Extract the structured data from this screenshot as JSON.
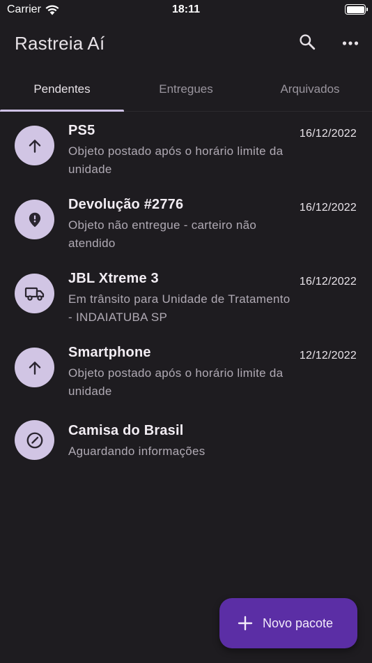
{
  "status_bar": {
    "carrier": "Carrier",
    "time": "18:11"
  },
  "app_bar": {
    "title": "Rastreia Aí",
    "search_icon": "search-icon",
    "more_icon": "more-horiz-icon"
  },
  "tabs": [
    {
      "label": "Pendentes",
      "active": true
    },
    {
      "label": "Entregues",
      "active": false
    },
    {
      "label": "Arquivados",
      "active": false
    }
  ],
  "packages": [
    {
      "title": "PS5",
      "description": "Objeto postado após o horário limite da unidade",
      "date": "16/12/2022",
      "icon": "arrow-up-icon"
    },
    {
      "title": "Devolução #2776",
      "description": "Objeto não entregue - carteiro não atendido",
      "date": "16/12/2022",
      "icon": "alert-pin-icon"
    },
    {
      "title": "JBL Xtreme 3",
      "description": "Em trânsito para Unidade de Tratamento - INDAIATUBA SP",
      "date": "16/12/2022",
      "icon": "truck-icon"
    },
    {
      "title": "Smartphone",
      "description": "Objeto postado após o horário limite da unidade",
      "date": "12/12/2022",
      "icon": "arrow-up-icon"
    },
    {
      "title": "Camisa do Brasil",
      "description": "Aguardando informações",
      "date": "",
      "icon": "pending-clock-icon"
    }
  ],
  "fab": {
    "label": "Novo pacote",
    "icon": "plus-icon"
  },
  "colors": {
    "background": "#1e1c20",
    "avatar": "#d1c5e4",
    "fab": "#5b2ea5",
    "tab_indicator": "#cfc2e6"
  }
}
